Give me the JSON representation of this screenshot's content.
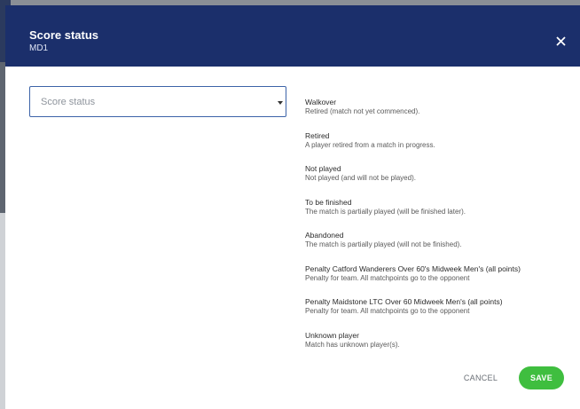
{
  "header": {
    "title": "Score status",
    "subtitle": "MD1",
    "close_icon": "close-icon"
  },
  "select": {
    "placeholder": "Score status",
    "arrow_icon": "dropdown-arrow-icon"
  },
  "options": [
    {
      "name": "Walkover",
      "description": "Retired (match not yet commenced)."
    },
    {
      "name": "Retired",
      "description": "A player retired from a match in progress."
    },
    {
      "name": "Not played",
      "description": "Not played (and will not be played)."
    },
    {
      "name": "To be finished",
      "description": "The match is partially played (will be finished later)."
    },
    {
      "name": "Abandoned",
      "description": "The match is partially played (will not be finished)."
    },
    {
      "name": "Penalty Catford Wanderers Over 60's Midweek Men's (all points)",
      "description": "Penalty for team. All matchpoints go to the opponent"
    },
    {
      "name": "Penalty Maidstone LTC Over 60 Midweek Men's (all points)",
      "description": "Penalty for team. All matchpoints go to the opponent"
    },
    {
      "name": "Unknown player",
      "description": "Match has unknown player(s)."
    }
  ],
  "footer": {
    "cancel_label": "CANCEL",
    "save_label": "SAVE"
  },
  "colors": {
    "header_bg": "#1b2f6b",
    "accent_border": "#3c63a8",
    "save_green": "#3fbe3f"
  }
}
